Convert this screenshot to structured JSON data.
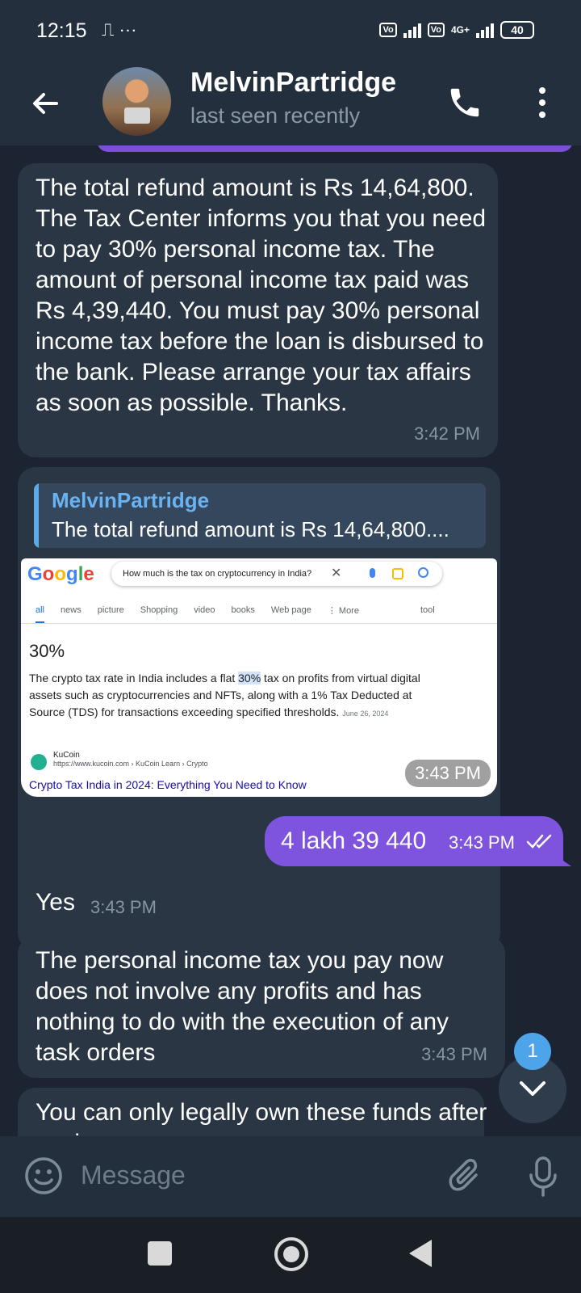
{
  "status_bar": {
    "time": "12:15",
    "battery": "40",
    "network": "4G+",
    "volte": "Vo\nLTE"
  },
  "header": {
    "name": "MelvinPartridge",
    "status": "last seen recently"
  },
  "messages": {
    "m1": {
      "text": "The total refund amount is Rs 14,64,800. The Tax Center informs you that you need to pay 30% personal income tax. The amount of personal income tax paid was Rs 4,39,440. You must pay 30% personal income tax before the loan is disbursed to the bank. Please arrange your tax affairs as soon as possible. Thanks.",
      "time": "3:42 PM"
    },
    "m2": {
      "reply_name": "MelvinPartridge",
      "reply_text": "The total refund amount is Rs 14,64,800....",
      "time": "3:43 PM",
      "screenshot": {
        "search_query": "How much is the tax on cryptocurrency in India?",
        "tabs": [
          "all",
          "news",
          "picture",
          "Shopping",
          "video",
          "books",
          "Web page",
          "⋮ More"
        ],
        "tool": "tool",
        "headline": "30%",
        "desc_before": "The crypto tax rate in India includes a flat ",
        "desc_highlight": "30%",
        "desc_after": " tax on profits from virtual digital assets such as cryptocurrencies and NFTs, along with a 1% Tax Deducted at Source (TDS) for transactions exceeding specified thresholds.",
        "date": "June 26, 2024",
        "source_name": "KuCoin",
        "source_url": "https://www.kucoin.com › KuCoin Learn › Crypto",
        "link": "Crypto Tax India in 2024: Everything You Need to Know"
      }
    },
    "m3": {
      "text": "4 lakh 39 440",
      "time": "3:43 PM"
    },
    "m4": {
      "text": "Yes",
      "time": "3:43 PM"
    },
    "m5": {
      "text": "The personal income tax you pay now does not involve any profits and has nothing to do with the execution of any task orders",
      "time": "3:43 PM"
    },
    "m6": {
      "text": "You can only legally own these funds after paying"
    }
  },
  "unread_badge": "1",
  "input": {
    "placeholder": "Message"
  }
}
